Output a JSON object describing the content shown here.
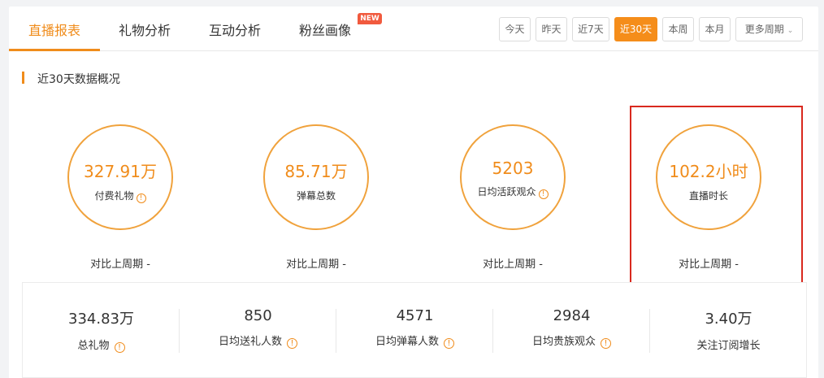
{
  "tabs": [
    {
      "label": "直播报表",
      "active": true
    },
    {
      "label": "礼物分析",
      "active": false
    },
    {
      "label": "互动分析",
      "active": false
    },
    {
      "label": "粉丝画像",
      "active": false,
      "badge": "NEW"
    }
  ],
  "periods": [
    {
      "label": "今天",
      "active": false
    },
    {
      "label": "昨天",
      "active": false
    },
    {
      "label": "近7天",
      "active": false
    },
    {
      "label": "近30天",
      "active": true
    },
    {
      "label": "本周",
      "active": false
    },
    {
      "label": "本月",
      "active": false
    }
  ],
  "more_periods": "更多周期",
  "section_title": "近30天数据概况",
  "circles": [
    {
      "value": "327.91万",
      "label": "付费礼物",
      "info": true,
      "compare": "对比上周期 -"
    },
    {
      "value": "85.71万",
      "label": "弹幕总数",
      "info": false,
      "compare": "对比上周期 -"
    },
    {
      "value": "5203",
      "label": "日均活跃观众",
      "info": true,
      "compare": "对比上周期 -"
    },
    {
      "value": "102.2小时",
      "label": "直播时长",
      "info": false,
      "compare": "对比上周期 -",
      "highlighted": true
    }
  ],
  "stats": [
    {
      "value": "334.83万",
      "label": "总礼物",
      "info": true
    },
    {
      "value": "850",
      "label": "日均送礼人数",
      "info": true
    },
    {
      "value": "4571",
      "label": "日均弹幕人数",
      "info": true
    },
    {
      "value": "2984",
      "label": "日均贵族观众",
      "info": true
    },
    {
      "value": "3.40万",
      "label": "关注订阅增长",
      "info": false
    }
  ],
  "icons": {
    "info": "!",
    "chevron": "⌄"
  },
  "colors": {
    "accent": "#f08c1b",
    "highlight_border": "#d9291e",
    "new_badge": "#f15a3e"
  }
}
